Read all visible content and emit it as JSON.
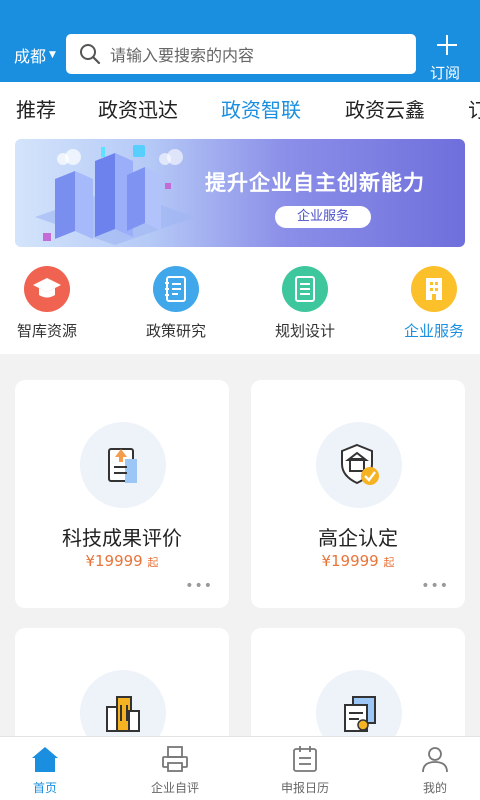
{
  "header": {
    "city": "成都",
    "search_placeholder": "请输入要搜索的内容",
    "subscribe_label": "订阅"
  },
  "tabs": [
    {
      "label": "推荐"
    },
    {
      "label": "政资迅达"
    },
    {
      "label": "政资智联",
      "active": true
    },
    {
      "label": "政资云鑫"
    },
    {
      "label": "订"
    }
  ],
  "banner": {
    "title": "提升企业自主创新能力",
    "tag": "企业服务"
  },
  "categories": [
    {
      "label": "智库资源",
      "icon": "graduation-cap-icon",
      "color": "#f06351"
    },
    {
      "label": "政策研究",
      "icon": "notebook-icon",
      "color": "#3fa7ea"
    },
    {
      "label": "规划设计",
      "icon": "document-icon",
      "color": "#3ec79c"
    },
    {
      "label": "企业服务",
      "icon": "building-icon",
      "color": "#fcc02b",
      "active": true
    }
  ],
  "cards": [
    {
      "title": "科技成果评价",
      "price": "¥19999",
      "price_suffix": "起",
      "more": "•••",
      "icon": "certificate-upload-icon"
    },
    {
      "title": "高企认定",
      "price": "¥19999",
      "price_suffix": "起",
      "more": "•••",
      "icon": "shield-check-icon"
    },
    {
      "title": "",
      "icon": "buildings-icon"
    },
    {
      "title": "",
      "icon": "documents-stamp-icon"
    }
  ],
  "bottom_nav": [
    {
      "label": "首页",
      "icon": "home-icon",
      "active": true
    },
    {
      "label": "企业自评",
      "icon": "printer-icon"
    },
    {
      "label": "申报日历",
      "icon": "calendar-icon"
    },
    {
      "label": "我的",
      "icon": "user-icon"
    }
  ],
  "colors": {
    "primary": "#1a8fe0",
    "price": "#e8743a",
    "background": "#f2f2f2"
  }
}
